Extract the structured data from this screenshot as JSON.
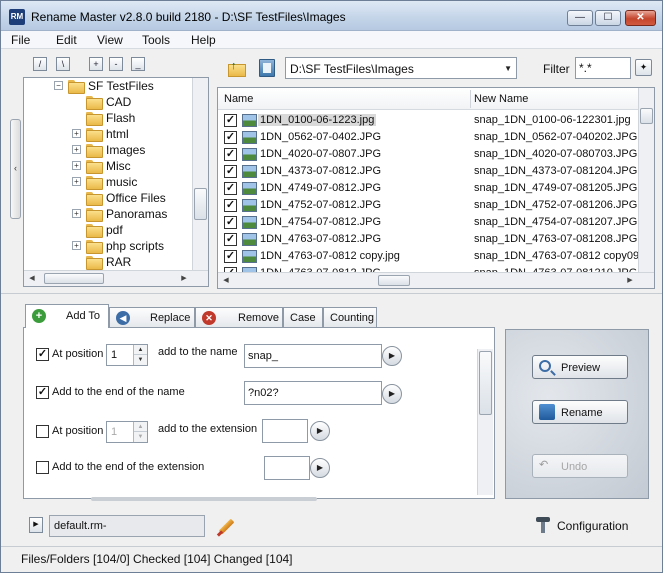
{
  "window": {
    "app_icon": "RM",
    "title": "Rename Master v2.8.0 build 2180 - D:\\SF TestFiles\\Images",
    "controls": {
      "minimize": "—",
      "maximize": "☐",
      "close": "✕"
    }
  },
  "menu": [
    "File",
    "Edit",
    "View",
    "Tools",
    "Help"
  ],
  "tree_toolbar": [
    "/",
    "\\",
    "+",
    "-"
  ],
  "tree": {
    "root": "SF TestFiles",
    "items": [
      {
        "label": "CAD",
        "expandable": false
      },
      {
        "label": "Flash",
        "expandable": false
      },
      {
        "label": "html",
        "expandable": true
      },
      {
        "label": "Images",
        "expandable": true
      },
      {
        "label": "Misc",
        "expandable": true
      },
      {
        "label": "music",
        "expandable": true
      },
      {
        "label": "Office Files",
        "expandable": false
      },
      {
        "label": "Panoramas",
        "expandable": true
      },
      {
        "label": "pdf",
        "expandable": false
      },
      {
        "label": "php scripts",
        "expandable": true
      },
      {
        "label": "RAR",
        "expandable": false
      }
    ]
  },
  "path_bar": {
    "path": "D:\\SF TestFiles\\Images",
    "filter_label": "Filter",
    "filter_value": "*.*",
    "filter_button": "✦"
  },
  "file_list": {
    "columns": [
      "Name",
      "New Name"
    ],
    "rows": [
      {
        "name": "1DN_0100-06-1223.jpg",
        "new_name": "snap_1DN_0100-06-122301.jpg",
        "checked": true,
        "selected": true
      },
      {
        "name": "1DN_0562-07-0402.JPG",
        "new_name": "snap_1DN_0562-07-040202.JPG",
        "checked": true
      },
      {
        "name": "1DN_4020-07-0807.JPG",
        "new_name": "snap_1DN_4020-07-080703.JPG",
        "checked": true
      },
      {
        "name": "1DN_4373-07-0812.JPG",
        "new_name": "snap_1DN_4373-07-081204.JPG",
        "checked": true
      },
      {
        "name": "1DN_4749-07-0812.JPG",
        "new_name": "snap_1DN_4749-07-081205.JPG",
        "checked": true
      },
      {
        "name": "1DN_4752-07-0812.JPG",
        "new_name": "snap_1DN_4752-07-081206.JPG",
        "checked": true
      },
      {
        "name": "1DN_4754-07-0812.JPG",
        "new_name": "snap_1DN_4754-07-081207.JPG",
        "checked": true
      },
      {
        "name": "1DN_4763-07-0812.JPG",
        "new_name": "snap_1DN_4763-07-081208.JPG",
        "checked": true
      },
      {
        "name": "1DN_4763-07-0812 copy.jpg",
        "new_name": "snap_1DN_4763-07-0812 copy09",
        "checked": true
      },
      {
        "name": "1DN_4763-07-0812.JPG",
        "new_name": "snap_1DN_4763-07-081210.JPG",
        "checked": true
      }
    ]
  },
  "tabs": [
    {
      "label": "Add To",
      "icon": "add-to-icon",
      "active": true
    },
    {
      "label": "Replace",
      "icon": "replace-icon"
    },
    {
      "label": "Remove",
      "icon": "remove-icon"
    },
    {
      "label": "Case"
    },
    {
      "label": "Counting"
    }
  ],
  "add_to": {
    "row1": {
      "checked": true,
      "label": "At position",
      "position": "1",
      "mid_label": "add to the name",
      "value": "snap_"
    },
    "row2": {
      "checked": true,
      "label": "Add to the end of the name",
      "value": "?n02?"
    },
    "row3": {
      "checked": false,
      "label": "At position",
      "position": "1",
      "mid_label": "add to the extension",
      "value": ""
    },
    "row4": {
      "checked": false,
      "label": "Add to the end of the extension",
      "value": ""
    }
  },
  "actions": {
    "preview": "Preview",
    "rename": "Rename",
    "undo": "Undo"
  },
  "preset": {
    "value": "default.rm-"
  },
  "configuration_label": "Configuration",
  "status": "Files/Folders [104/0] Checked [104] Changed [104]"
}
